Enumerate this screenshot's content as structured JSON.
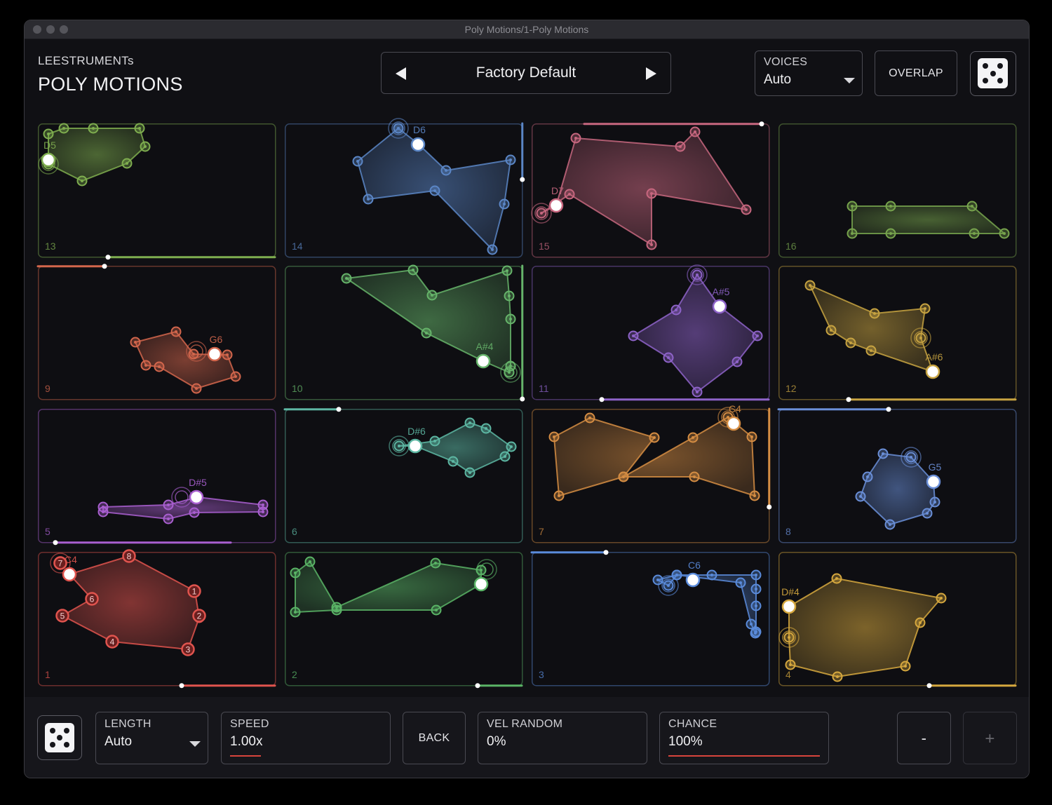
{
  "window": {
    "title": "Poly Motions/1-Poly Motions"
  },
  "header": {
    "brand": "LEESTRUMENTs",
    "title": "POLY MOTIONS",
    "preset": {
      "name": "Factory Default",
      "prev_icon": "triangle-left-icon",
      "next_icon": "triangle-right-icon"
    },
    "voices": {
      "label": "VOICES",
      "value": "Auto"
    },
    "overlap_label": "OVERLAP",
    "dice_icon": "dice-five-icon"
  },
  "pads": [
    {
      "number": "13",
      "note": "D5",
      "color": "#7fae4f"
    },
    {
      "number": "14",
      "note": "D6",
      "color": "#5b86c6"
    },
    {
      "number": "15",
      "note": "D7",
      "color": "#c7677f"
    },
    {
      "number": "16",
      "note": "",
      "color": "#77a44d"
    },
    {
      "number": "9",
      "note": "G6",
      "color": "#d3664c"
    },
    {
      "number": "10",
      "note": "A#4",
      "color": "#66b46a"
    },
    {
      "number": "11",
      "note": "A#5",
      "color": "#8e63c9"
    },
    {
      "number": "12",
      "note": "A#6",
      "color": "#c7a341"
    },
    {
      "number": "5",
      "note": "D#5",
      "color": "#a95fd0"
    },
    {
      "number": "6",
      "note": "D#6",
      "color": "#5db7a3"
    },
    {
      "number": "7",
      "note": "C4",
      "color": "#d58d43"
    },
    {
      "number": "8",
      "note": "G5",
      "color": "#6a8fd8"
    },
    {
      "number": "1",
      "note": "C4",
      "color": "#e0544e"
    },
    {
      "number": "2",
      "note": "",
      "color": "#5ab466"
    },
    {
      "number": "3",
      "note": "C6",
      "color": "#5a8bdb"
    },
    {
      "number": "4",
      "note": "D#4",
      "color": "#d6a83e"
    }
  ],
  "pad1_vertex_labels": [
    "1",
    "2",
    "3",
    "4",
    "5",
    "6",
    "7",
    "8"
  ],
  "footer": {
    "dice_icon": "dice-five-icon",
    "length": {
      "label": "LENGTH",
      "value": "Auto"
    },
    "speed": {
      "label": "SPEED",
      "value": "1.00x"
    },
    "back_label": "BACK",
    "vel_random": {
      "label": "VEL RANDOM",
      "value": "0%"
    },
    "chance": {
      "label": "CHANCE",
      "value": "100%",
      "level": 1.0
    },
    "minus_label": "-",
    "plus_label": "+"
  },
  "accent_color": "#d8453c"
}
